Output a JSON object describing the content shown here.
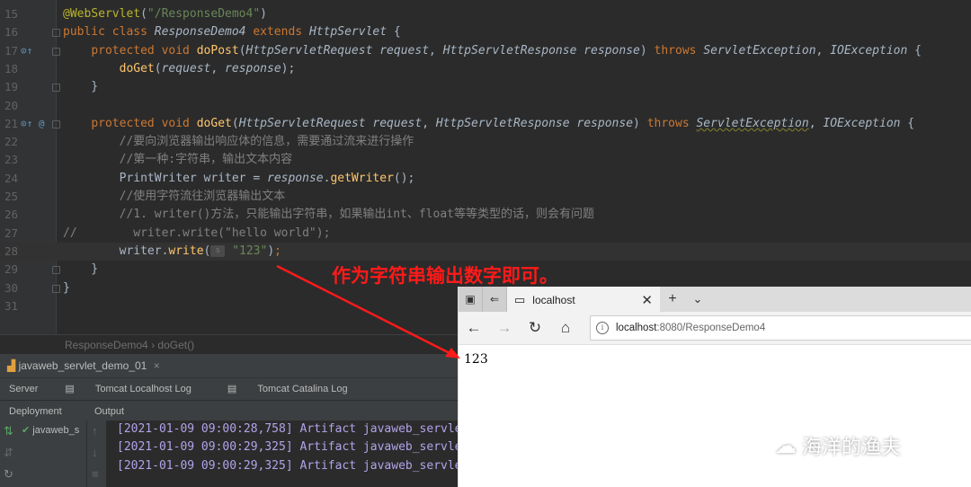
{
  "editor": {
    "lines": [
      {
        "num": "15",
        "kind": "ann",
        "text": "@WebServlet(\"/ResponseDemo4\")"
      },
      {
        "num": "16",
        "kind": "class",
        "text": "public class ResponseDemo4 extends HttpServlet {"
      },
      {
        "num": "17",
        "kind": "method",
        "text": "protected void doPost(HttpServletRequest request, HttpServletResponse response) throws ServletException, IOException {"
      },
      {
        "num": "18",
        "kind": "call",
        "text": "doGet(request, response);"
      },
      {
        "num": "19",
        "kind": "brace",
        "text": "}"
      },
      {
        "num": "20",
        "kind": "empty",
        "text": ""
      },
      {
        "num": "21",
        "kind": "method2",
        "text": "protected void doGet(HttpServletRequest request, HttpServletResponse response) throws ServletException, IOException {"
      },
      {
        "num": "22",
        "kind": "comment",
        "text": "//要向浏览器输出响应体的信息，需要通过流来进行操作"
      },
      {
        "num": "23",
        "kind": "comment",
        "text": "//第一种:字符串，输出文本内容"
      },
      {
        "num": "24",
        "kind": "writer",
        "text": "PrintWriter writer = response.getWriter();"
      },
      {
        "num": "25",
        "kind": "comment",
        "text": "//使用字符流往浏览器输出文本"
      },
      {
        "num": "26",
        "kind": "comment",
        "text": "//1. writer()方法，只能输出字符串，如果输出int、float等等类型的话，则会有问题"
      },
      {
        "num": "27",
        "kind": "comment2",
        "text": "//        writer.write(\"hello world\");"
      },
      {
        "num": "28",
        "kind": "write",
        "text": "writer.write( \"123\");"
      },
      {
        "num": "29",
        "kind": "brace",
        "text": "}"
      },
      {
        "num": "30",
        "kind": "brace0",
        "text": "}"
      },
      {
        "num": "31",
        "kind": "empty",
        "text": ""
      }
    ]
  },
  "breadcrumb": {
    "class_name": "ResponseDemo4",
    "separator": "›",
    "method": "doGet()"
  },
  "run": {
    "title": "javaweb_servlet_demo_01",
    "tabs": [
      "Server",
      "Tomcat Localhost Log",
      "Tomcat Catalina Log"
    ],
    "subtabs": [
      "Deployment",
      "Output"
    ],
    "deployment_item": "javaweb_s",
    "log": [
      "[2021-01-09 09:00:28,758] Artifact javaweb_servle",
      "[2021-01-09 09:00:29,325] Artifact javaweb_servle",
      "[2021-01-09 09:00:29,325] Artifact javaweb_servle"
    ]
  },
  "browser": {
    "tab_title": "localhost",
    "url_host": "localhost",
    "url_path": ":8080/ResponseDemo4",
    "content": "123"
  },
  "annotation_text": "作为字符串输出数字即可。",
  "watermark_text": "海洋的渔夫",
  "colors": {
    "annotation": "#ff1a1a",
    "keyword": "#cc7832",
    "string": "#6a8759"
  }
}
